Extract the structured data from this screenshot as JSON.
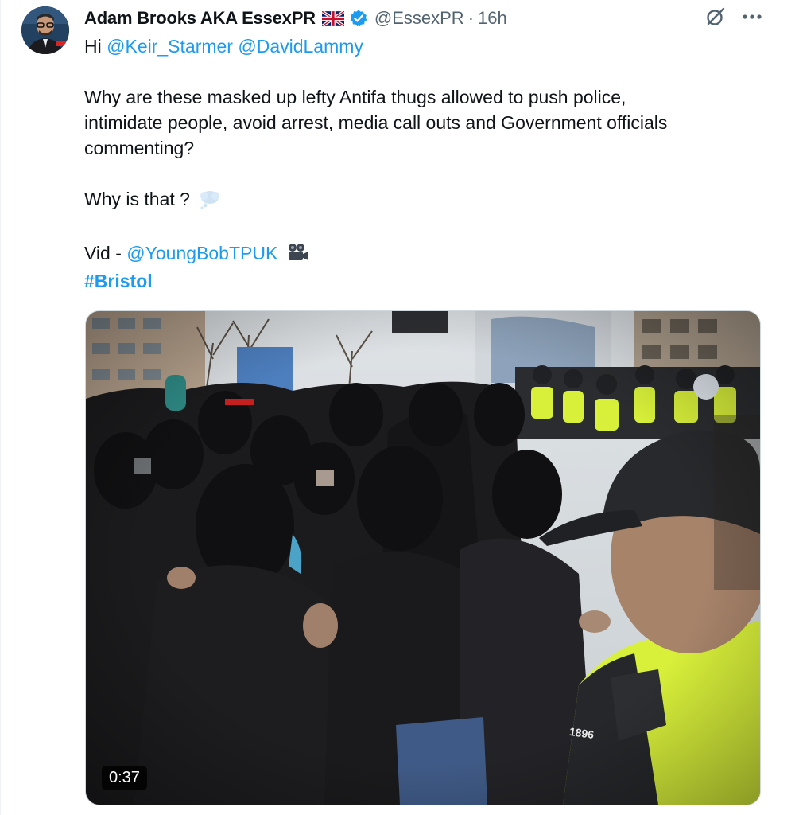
{
  "tweet": {
    "author_name": "Adam Brooks AKA EssexPR",
    "handle": "@EssexPR",
    "separator": "·",
    "time": "16h",
    "greeting": "Hi",
    "mention_1": "@Keir_Starmer",
    "mention_2": "@DavidLammy",
    "para_1": [
      "Why are these masked up lefty Antifa thugs allowed to push police,",
      "intimidate people, avoid arrest, media call outs and Government officials",
      "commenting?"
    ],
    "para_2": "Why is that ?",
    "vid_prefix": "Vid - ",
    "vid_mention": "@YoungBobTPUK",
    "hashtag": "#Bristol"
  },
  "media": {
    "duration": "0:37",
    "badge_number": "1896"
  },
  "icons": {
    "flag": "uk-flag-icon",
    "verified": "verified-badge-icon",
    "grok": "grok-icon",
    "more": "more-options-icon",
    "thought": "thought-balloon-icon",
    "camera": "movie-camera-icon"
  },
  "colors": {
    "link": "#1d9bf0",
    "verified": "#1d9bf0",
    "text": "#0f1419",
    "muted": "#536471",
    "hi_vis": "#d8f03a"
  }
}
